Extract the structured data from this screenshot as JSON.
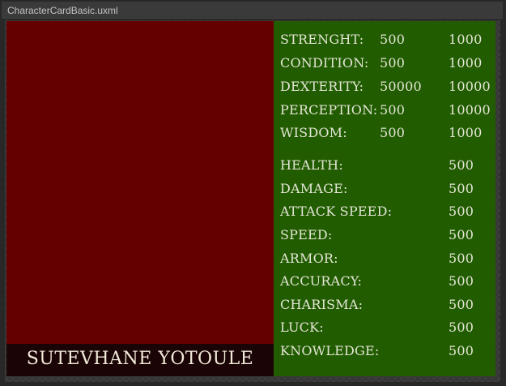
{
  "window": {
    "title": "CharacterCardBasic.uxml"
  },
  "character": {
    "name": "SUTEVHANE YOTOULE"
  },
  "attributes": [
    {
      "label": "STRENGHT:",
      "value": "500",
      "max": "1000"
    },
    {
      "label": "CONDITION:",
      "value": "500",
      "max": "1000"
    },
    {
      "label": "DEXTERITY:",
      "value": "50000",
      "max": "10000"
    },
    {
      "label": "PERCEPTION:",
      "value": "500",
      "max": "10000"
    },
    {
      "label": "WISDOM:",
      "value": "500",
      "max": "1000"
    }
  ],
  "derived": [
    {
      "label": "HEALTH:",
      "value": "500"
    },
    {
      "label": "DAMAGE:",
      "value": "500"
    },
    {
      "label": "ATTACK SPEED:",
      "value": "500"
    },
    {
      "label": "SPEED:",
      "value": "500"
    },
    {
      "label": "ARMOR:",
      "value": "500"
    },
    {
      "label": "ACCURACY:",
      "value": "500"
    },
    {
      "label": "CHARISMA:",
      "value": "500"
    },
    {
      "label": "LUCK:",
      "value": "500"
    },
    {
      "label": "KNOWLEDGE:",
      "value": "500"
    }
  ],
  "colors": {
    "portrait": "#650000",
    "nameplate": "#1a0405",
    "stats_panel": "#225c00",
    "text": "#e3e6d6"
  }
}
